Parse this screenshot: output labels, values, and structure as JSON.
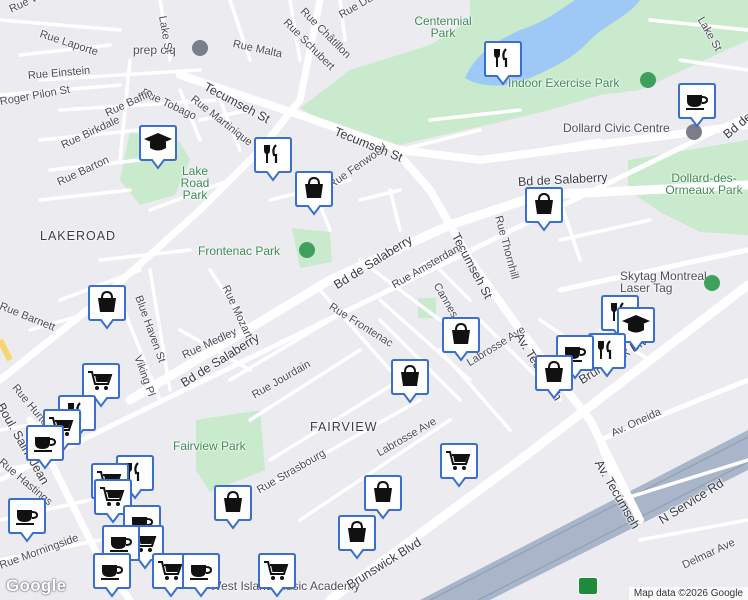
{
  "map": {
    "attribution": "Map data ©2026 Google",
    "logo": "Google",
    "colors": {
      "land": "#ececf0",
      "road": "#ffffff",
      "park": "#c9eacd",
      "water": "#9ec8f5",
      "highway": "#a9b6c9",
      "pin_fill": "#ffffff",
      "pin_border": "#3a6fcf",
      "pin_icon": "#111111"
    },
    "neighborhoods": [
      "LAKEROAD",
      "FAIRVIEW"
    ],
    "parks": [
      "Centennial Park",
      "Lake Road Park",
      "Frontenac Park",
      "Fairview Park",
      "Dollard-des-Ormeaux Park",
      "Indoor Exercise Park"
    ],
    "pois": [
      "prep ciq",
      "Dollard Civic Centre",
      "Skytag Montreal - Laser Tag",
      "West Island Music Academy"
    ],
    "streets": [
      "Rue Walker",
      "Rue Laporte",
      "Rue Malta",
      "Rue Schubert",
      "Rue Châtillon",
      "Rue Dalton",
      "Lake St",
      "Rue Einstein",
      "Roger Pilon St",
      "Rue Tobago",
      "Rue Baffin",
      "Rue Martinique",
      "Rue Birkdale",
      "Rue Barton",
      "Rue Fenwood",
      "Tecumseh St",
      "Bd de Salaberry",
      "Rue Thornhill",
      "Rue Amsterdam",
      "Cannes",
      "Rue Frontenac",
      "Rue Mozart",
      "Blue Haven St",
      "Rue Barnett",
      "Rue Medley",
      "Viking Pl",
      "Rue Hurteau",
      "Boul. Saint-Jean",
      "Rue Jourdain",
      "Labrosse Ave",
      "Av. Tecumseh",
      "Av. Oneida",
      "Brunswick Blvd",
      "N Service Rd",
      "Delmar Ave",
      "Rue Strasbourg",
      "Rue Hastings",
      "Rue Morningside"
    ],
    "pins": [
      "restaurant",
      "cafe",
      "shopping",
      "school",
      "grocery"
    ]
  }
}
